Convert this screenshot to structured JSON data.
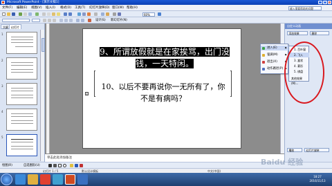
{
  "window": {
    "title": "Microsoft PowerPoint - [演示文稿1]",
    "controls": [
      "_",
      "□",
      "×"
    ]
  },
  "menu": {
    "items": [
      "文件(F)",
      "编辑(E)",
      "视图(V)",
      "插入(I)",
      "格式(O)",
      "工具(T)",
      "幻灯片放映(D)",
      "窗口(W)",
      "帮助(H)"
    ],
    "help_placeholder": "键入需要帮助的问题"
  },
  "toolbar": {
    "zoom": "60%"
  },
  "toolbar2": {
    "design_label": "设计(S)",
    "new_slide_label": "新幻灯片(N)"
  },
  "left_panel": {
    "tabs": [
      "大纲",
      "幻灯片"
    ],
    "slide_numbers": [
      "1",
      "2",
      "3",
      "4",
      "5"
    ]
  },
  "slide": {
    "title_prefix": "9",
    "title_rest": "、所谓放假就是在家挨骂，出门没钱，一天特闲。",
    "body": "10、以后不要再说你一无所有了，你不是有病吗？",
    "marker": "1"
  },
  "task_pane": {
    "header": "自定义动画",
    "add_effect": "添加效果",
    "remove": "删除",
    "reorder": "重新排序",
    "play": "播放",
    "slideshow": "幻灯片放映"
  },
  "context_menu": {
    "items": [
      "进入(E)",
      "强调(M)",
      "退出(X)",
      "动作路径(P)"
    ]
  },
  "submenu": {
    "items": [
      "1. 百叶窗",
      "2. 飞入",
      "3. 盒状",
      "4. 菱形",
      "5. 棋盘",
      "其他效果(M)..."
    ]
  },
  "notes": {
    "text": "单击此处添加备注"
  },
  "draw_toolbar": {
    "draw_label": "绘图(R)",
    "autoshape_label": "自选图形(U)"
  },
  "status": {
    "slide_info": "幻灯片 1 / 5",
    "design": "默认设计模板",
    "language": "中文(中国)"
  },
  "taskbar": {
    "time": "18:27",
    "date": "2016/11/13"
  },
  "watermark": "Baidu 经验",
  "colors": {
    "title_bar": "#1a58d6",
    "highlight_circle": "#d9181e",
    "slide_highlight_bg": "#000000"
  }
}
